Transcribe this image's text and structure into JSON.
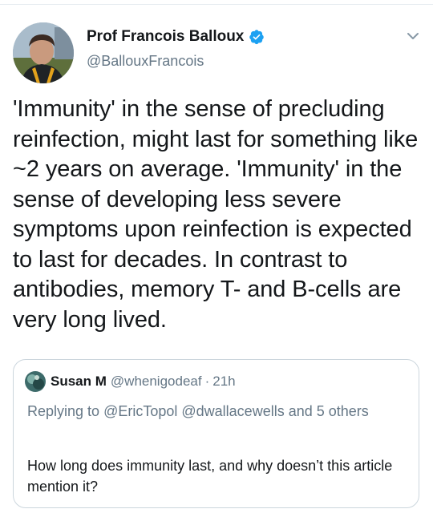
{
  "tweet": {
    "author_name": "Prof Francois Balloux",
    "author_handle": "@BallouxFrancois",
    "verified": true,
    "menu_icon": "chevron-down-icon",
    "text": "'Immunity' in the sense of precluding reinfection, might last for something like ~2 years on average. 'Immunity' in the sense of developing less severe symptoms upon reinfection is expected to last for decades. In contrast to antibodies, memory T- and B-cells are very long lived."
  },
  "quoted_tweet": {
    "author_name": "Susan M",
    "author_handle": "@whenigodeaf",
    "separator": "·",
    "time": "21h",
    "replying_prefix": "Replying to",
    "replying_users": "@EricTopol @dwallacewells and 5 others",
    "text": "How long does immunity last, and why doesn’t this article mention it?"
  },
  "colors": {
    "text_primary": "#14171a",
    "text_secondary": "#657786",
    "verified_blue": "#1da1f2",
    "border": "#ccd6dd"
  }
}
